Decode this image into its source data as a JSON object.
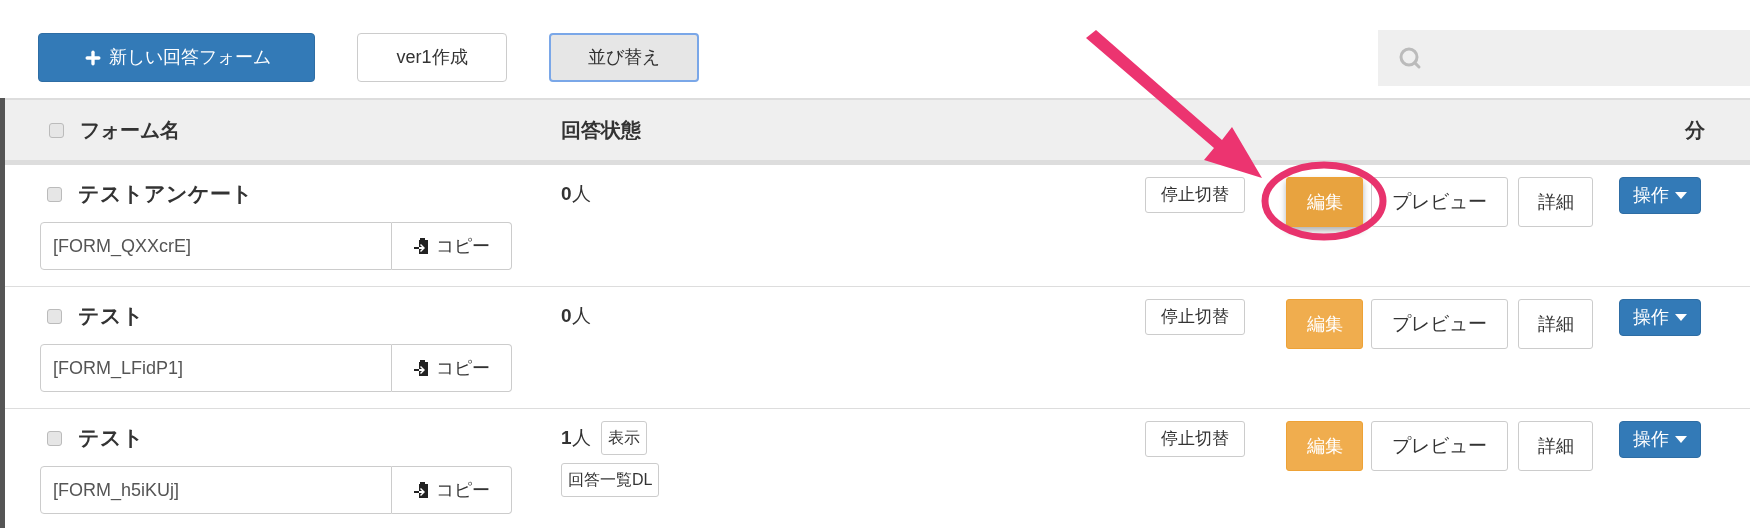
{
  "toolbar": {
    "new_button": "新しい回答フォーム",
    "buttons": [
      {
        "label": "ver1作成",
        "selected": false
      },
      {
        "label": "並び替え",
        "selected": true
      }
    ]
  },
  "table": {
    "header": {
      "checked": false,
      "columns": [
        "フォーム名",
        "回答状態",
        "分"
      ]
    },
    "rows": [
      {
        "name": "テストアンケート",
        "checked": false,
        "code": "[FORM_QXXcrE]",
        "copy_label": "コピー",
        "count": "0",
        "count_unit": "人",
        "stop": "停止切替",
        "edit": "編集",
        "edit_highlighted": true,
        "preview": "プレビュー",
        "detail": "詳細",
        "menu": "操作"
      },
      {
        "name": "テスト",
        "checked": false,
        "code": "[FORM_LFidP1]",
        "copy_label": "コピー",
        "count": "0",
        "count_unit": "人",
        "stop": "停止切替",
        "edit": "編集",
        "edit_highlighted": false,
        "preview": "プレビュー",
        "detail": "詳細",
        "menu": "操作"
      },
      {
        "name": "テスト",
        "checked": false,
        "code": "[FORM_h5iKUj]",
        "copy_label": "コピー",
        "count": "1",
        "count_unit": "人",
        "show_label": "表示",
        "download_label": "回答一覧DL",
        "stop": "停止切替",
        "edit": "編集",
        "edit_highlighted": false,
        "preview": "プレビュー",
        "detail": "詳細",
        "menu": "操作"
      }
    ]
  }
}
